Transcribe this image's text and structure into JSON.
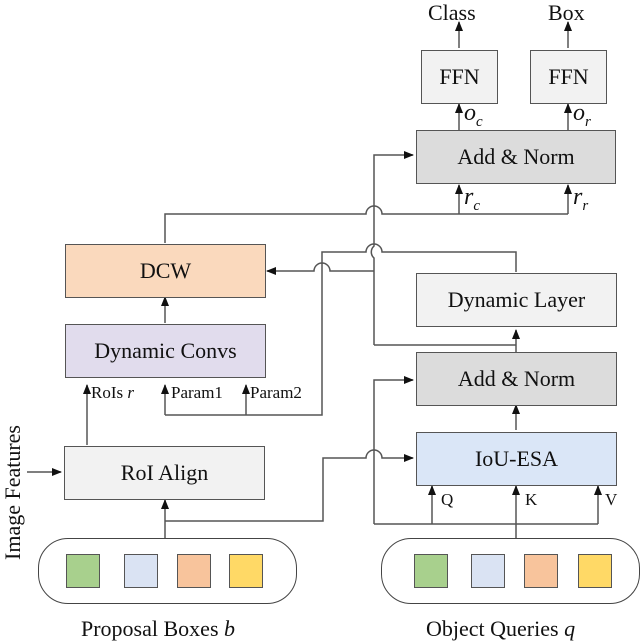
{
  "outputs": {
    "class": "Class",
    "box": "Box"
  },
  "blocks": {
    "ffn_class": "FFN",
    "ffn_box": "FFN",
    "add_norm_top": "Add & Norm",
    "dcw": "DCW",
    "dynamic_convs": "Dynamic Convs",
    "roi_align": "RoI Align",
    "dynamic_layer": "Dynamic Layer",
    "add_norm_mid": "Add & Norm",
    "iou_esa": "IoU-ESA"
  },
  "edge_labels": {
    "o": "o",
    "o_c_sub": "c",
    "o_r_sub": "r",
    "r": "r",
    "r_c_sub": "c",
    "r_r_sub": "r",
    "rois": "RoIs",
    "rois_var": "r",
    "param1": "Param1",
    "param2": "Param2",
    "q": "Q",
    "k": "K",
    "v": "V"
  },
  "inputs": {
    "image_features": "Image Features",
    "proposal_boxes": "Proposal Boxes",
    "proposal_boxes_var": "b",
    "object_queries": "Object Queries",
    "object_queries_var": "q"
  },
  "colors": {
    "ffn": "#f2f2f2",
    "add_norm": "#dcdcdc",
    "dcw": "#fad9bd",
    "dynamic_convs": "#e1dced",
    "roi_align": "#f2f2f2",
    "dynamic_layer": "#f2f2f2",
    "iou_esa": "#dae6f7",
    "token_green": "#a8d08d",
    "token_blue": "#dae3f3",
    "token_orange": "#f8c49c",
    "token_yellow": "#ffd966"
  }
}
